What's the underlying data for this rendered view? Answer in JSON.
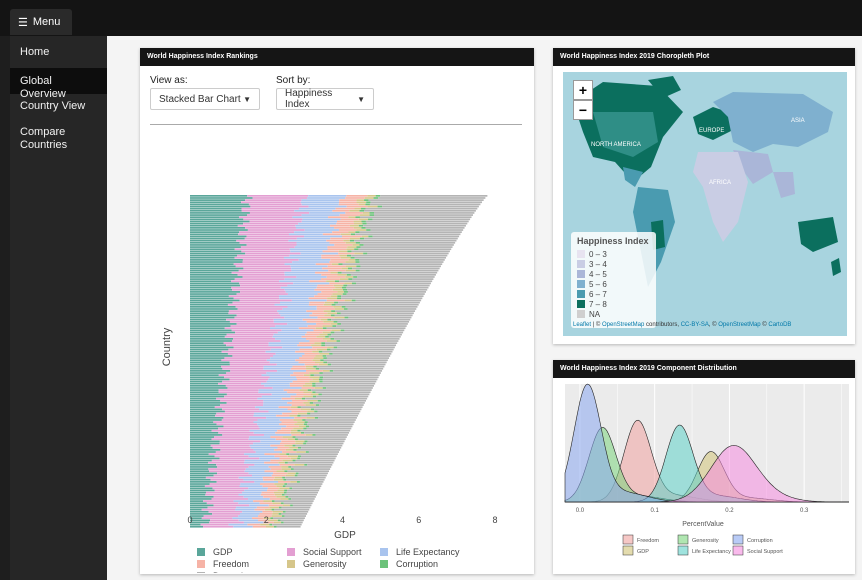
{
  "topbar": {
    "menu_label": "Menu"
  },
  "sidebar": {
    "items": [
      {
        "label": "Home"
      },
      {
        "label": "Global Overview"
      },
      {
        "label": "Country View"
      },
      {
        "label": "Compare Countries"
      }
    ],
    "active_index": 1
  },
  "rankings": {
    "title": "World Happiness Index Rankings",
    "view_as_label": "View as:",
    "view_as_value": "Stacked Bar Chart",
    "sort_by_label": "Sort by:",
    "sort_by_value": "Happiness Index"
  },
  "map": {
    "title": "World Happiness Index 2019 Choropleth Plot",
    "zoom_in": "+",
    "zoom_out": "−",
    "legend_title": "Happiness Index",
    "legend_items": [
      "0 – 3",
      "3 – 4",
      "4 – 5",
      "5 – 6",
      "6 – 7",
      "7 – 8",
      "NA"
    ],
    "legend_colors": [
      "#e7e3f0",
      "#c9cde4",
      "#aab6d8",
      "#7fb0cf",
      "#4a9bb0",
      "#0b6f5e",
      "#cfcfcf"
    ],
    "attribution_leaflet": "Leaflet",
    "attribution_mid": " | © ",
    "attribution_osm": "OpenStreetMap",
    "attribution_contrib": " contributors, ",
    "attribution_cc": "CC-BY-SA",
    "attribution_sep": ", © ",
    "attribution_osm2": "OpenStreetMap",
    "attribution_sep2": " © ",
    "attribution_carto": "CartoDB",
    "labels": [
      "NORTH AMERICA",
      "EUROPE",
      "ASIA",
      "AFRICA"
    ]
  },
  "distribution": {
    "title": "World Happiness Index 2019 Component Distribution"
  },
  "chart_data": [
    {
      "type": "bar",
      "orientation": "horizontal-stacked",
      "xlabel": "GDP",
      "ylabel": "Country",
      "xlim": [
        0,
        8
      ],
      "x_ticks": [
        "0",
        "2",
        "4",
        "6",
        "8"
      ],
      "country_count": 156,
      "components": [
        "GDP",
        "Social Support",
        "Life Expectancy",
        "Freedom",
        "Generosity",
        "Corruption",
        "Dystopia"
      ],
      "component_colors": {
        "GDP": "#5aa69a",
        "Social Support": "#e39fd2",
        "Life Expectancy": "#a9c4ee",
        "Freedom": "#f6b3a6",
        "Generosity": "#d6c68a",
        "Corruption": "#6cc27a",
        "Dystopia": "#b4b4b4"
      },
      "totals_range": [
        2.9,
        7.8
      ],
      "legend": [
        [
          "GDP",
          "Social Support",
          "Life Expectancy"
        ],
        [
          "Freedom",
          "Generosity",
          "Corruption"
        ],
        [
          "Dystopia"
        ]
      ]
    },
    {
      "type": "area",
      "subtype": "density",
      "xlabel": "PercentValue",
      "x_ticks": [
        "0.0",
        "0.1",
        "0.2",
        "0.3"
      ],
      "xlim": [
        -0.02,
        0.36
      ],
      "series": [
        {
          "name": "Freedom",
          "color": "#f0a3a0",
          "peak_x": 0.077,
          "peak_h": 0.68
        },
        {
          "name": "GDP",
          "color": "#d2c478",
          "peak_x": 0.175,
          "peak_h": 0.42
        },
        {
          "name": "Generosity",
          "color": "#7cd67d",
          "peak_x": 0.03,
          "peak_h": 0.62
        },
        {
          "name": "Life Expectancy",
          "color": "#5fd1c8",
          "peak_x": 0.133,
          "peak_h": 0.64
        },
        {
          "name": "Corruption",
          "color": "#8aa8f0",
          "peak_x": 0.01,
          "peak_h": 0.98
        },
        {
          "name": "Social Support",
          "color": "#f58ce0",
          "peak_x": 0.205,
          "peak_h": 0.47
        }
      ],
      "legend": [
        [
          "Freedom",
          "Generosity",
          "Corruption"
        ],
        [
          "GDP",
          "Life Expectancy",
          "Social Support"
        ]
      ]
    }
  ]
}
